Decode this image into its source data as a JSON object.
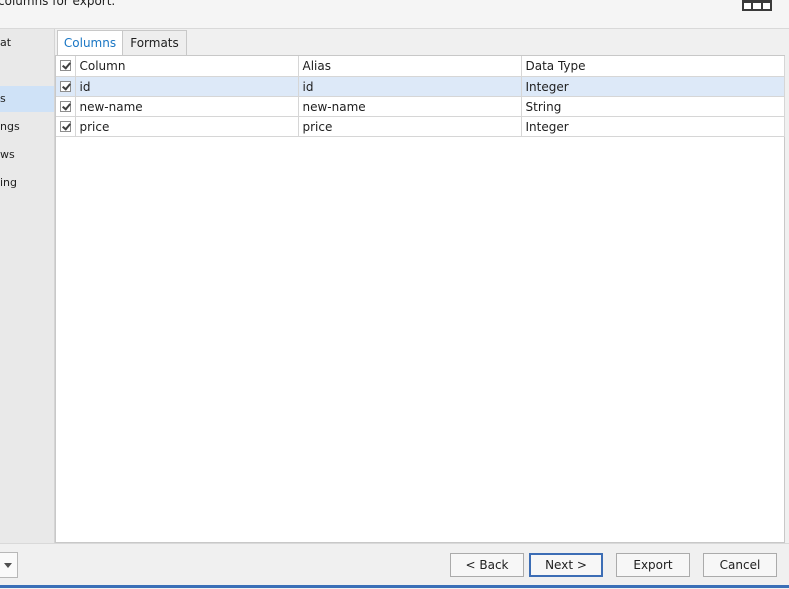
{
  "header": {
    "instruction_text": "columns for export."
  },
  "sidebar": {
    "items": [
      {
        "label": "at",
        "selected": false
      },
      {
        "label": "s",
        "selected": true
      },
      {
        "label": "ngs",
        "selected": false
      },
      {
        "label": "ws",
        "selected": false
      },
      {
        "label": "ing",
        "selected": false
      }
    ]
  },
  "tabs": [
    {
      "label": "Columns",
      "active": true
    },
    {
      "label": "Formats",
      "active": false
    }
  ],
  "grid": {
    "columns": [
      "Column",
      "Alias",
      "Data Type"
    ],
    "rows": [
      {
        "checked": true,
        "column": "id",
        "alias": "id",
        "data_type": "Integer",
        "selected": true
      },
      {
        "checked": true,
        "column": "new-name",
        "alias": "new-name",
        "data_type": "String",
        "selected": false
      },
      {
        "checked": true,
        "column": "price",
        "alias": "price",
        "data_type": "Integer",
        "selected": false
      }
    ]
  },
  "footer": {
    "back_label": "< Back",
    "next_label": "Next >",
    "export_label": "Export",
    "cancel_label": "Cancel"
  },
  "icons": {
    "view_icon": "grid-icon",
    "dropdown_icon": "chevron-down-icon"
  },
  "colors": {
    "accent": "#1976c4",
    "selection": "#dde9f8",
    "sidebar_selected": "#cfe2f7"
  }
}
